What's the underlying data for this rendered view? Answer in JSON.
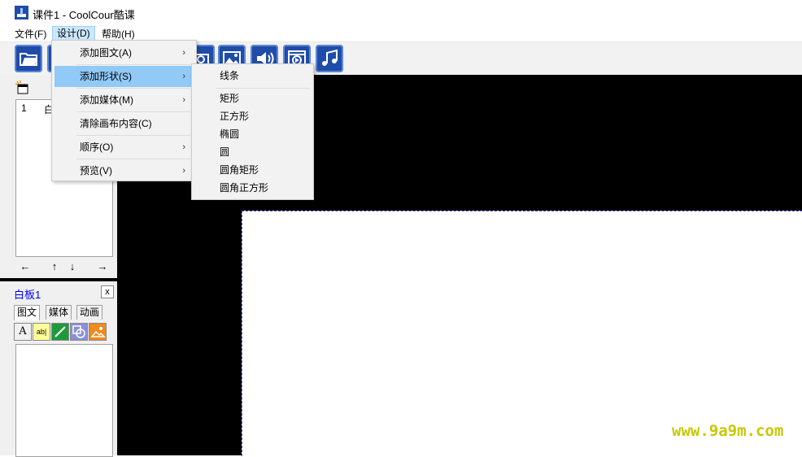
{
  "window": {
    "title": "课件1 - CoolCour酷课"
  },
  "menubar": {
    "file": "文件(F)",
    "design": "设计(D)",
    "help": "帮助(H)"
  },
  "toolbar": {
    "icons": [
      "open-folder-icon",
      "new-icon",
      "camera-icon",
      "image-icon",
      "audio-icon",
      "video-icon",
      "music-icon"
    ]
  },
  "design_menu": {
    "items": [
      {
        "label": "添加图文(A)",
        "has_submenu": true
      },
      {
        "label": "添加形状(S)",
        "has_submenu": true
      },
      {
        "label": "添加媒体(M)",
        "has_submenu": true
      },
      {
        "label": "清除画布内容(C)",
        "has_submenu": false
      },
      {
        "label": "顺序(O)",
        "has_submenu": true
      },
      {
        "label": "预览(V)",
        "has_submenu": true
      }
    ],
    "arrow": "›"
  },
  "shape_menu": {
    "items": [
      "线条",
      "矩形",
      "正方形",
      "椭圆",
      "圆",
      "圆角矩形",
      "圆角正方形"
    ]
  },
  "slides": {
    "rows": [
      {
        "num": "1",
        "name": "白"
      }
    ],
    "nav": {
      "left": "←",
      "up": "↑",
      "down": "↓",
      "right": "→"
    }
  },
  "whiteboard": {
    "title": "白板1",
    "close": "x",
    "tabs": [
      "图文",
      "媒体",
      "动画"
    ],
    "tools": [
      "text-tool-icon",
      "label-tool-icon",
      "line-tool-icon",
      "shape-tool-icon",
      "picture-tool-icon"
    ],
    "label_tool_text": "ab|",
    "text_tool_text": "A"
  },
  "watermark": "www.9a9m.com",
  "colors": {
    "toolbar_button": "#1f4ca8",
    "menu_highlight": "#91c9f7",
    "canvas": "#000000",
    "whiteboard_title": "#0000ff",
    "watermark": "#c8c800"
  }
}
